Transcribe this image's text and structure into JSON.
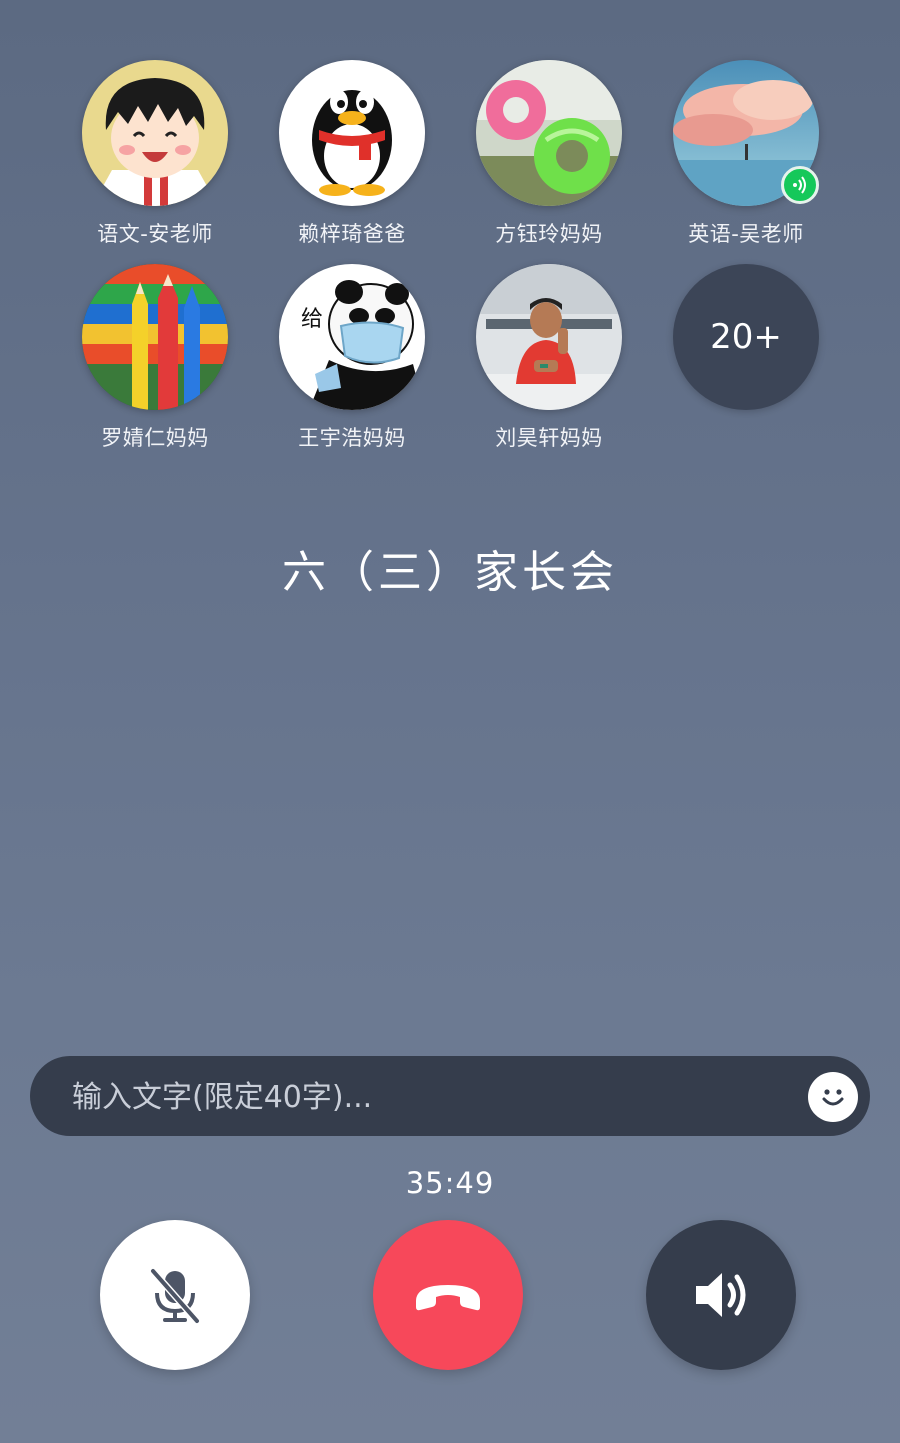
{
  "members": [
    {
      "name": "语文-安老师",
      "avatar": "cartoon-girl-avatar"
    },
    {
      "name": "赖梓琦爸爸",
      "avatar": "penguin-avatar"
    },
    {
      "name": "方钰玲妈妈",
      "avatar": "swim-rings-avatar"
    },
    {
      "name": "英语-吴老师",
      "avatar": "sky-clouds-avatar",
      "speaking": true
    },
    {
      "name": "罗婧仁妈妈",
      "avatar": "colored-pencils-avatar"
    },
    {
      "name": "王宇浩妈妈",
      "avatar": "panda-mask-avatar",
      "avatar_text": "给"
    },
    {
      "name": "刘昊轩妈妈",
      "avatar": "boy-photo-avatar"
    }
  ],
  "more_members": "20+",
  "group_title": "六（三）家长会",
  "message_input": {
    "placeholder": "输入文字(限定40字)...",
    "value": ""
  },
  "call_timer": "35:49",
  "controls": {
    "mute": {
      "icon": "mic-off-icon"
    },
    "hangup": {
      "icon": "phone-hangup-icon"
    },
    "speaker": {
      "icon": "speaker-icon"
    }
  },
  "colors": {
    "hangup": "#f7485a",
    "speaking": "#15c85a",
    "dark_control": "#353d4c"
  }
}
